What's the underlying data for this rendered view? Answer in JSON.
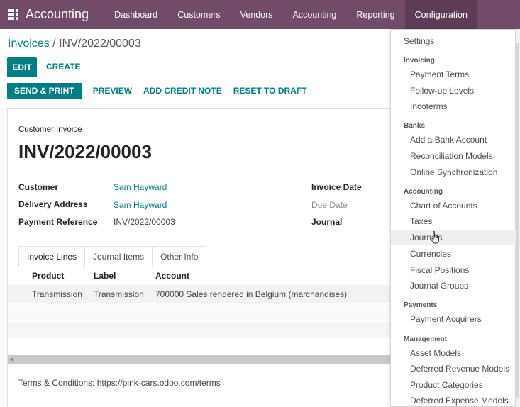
{
  "navbar": {
    "brand": "Accounting",
    "items": [
      "Dashboard",
      "Customers",
      "Vendors",
      "Accounting",
      "Reporting",
      "Configuration"
    ],
    "bg_color": "#714B67"
  },
  "breadcrumb": {
    "parent": "Invoices",
    "separator": "/",
    "current": "INV/2022/00003"
  },
  "actions": {
    "edit": "EDIT",
    "create": "CREATE",
    "send_print": "SEND & PRINT",
    "preview": "PREVIEW",
    "add_credit_note": "ADD CREDIT NOTE",
    "reset_to_draft": "RESET TO DRAFT"
  },
  "invoice": {
    "type": "Customer Invoice",
    "name": "INV/2022/00003",
    "customer_label": "Customer",
    "customer": "Sam Hayward",
    "delivery_label": "Delivery Address",
    "delivery": "Sam Hayward",
    "payment_ref_label": "Payment Reference",
    "payment_ref": "INV/2022/00003",
    "invoice_date_label": "Invoice Date",
    "due_date_label": "Due Date",
    "journal_label": "Journal"
  },
  "tabs": [
    "Invoice Lines",
    "Journal Items",
    "Other Info"
  ],
  "lines": {
    "headers": [
      "Product",
      "Label",
      "Account"
    ],
    "rows": [
      {
        "product": "Transmission",
        "label": "Transmission",
        "account": "700000 Sales rendered in Belgium (marchandises)"
      }
    ]
  },
  "terms": "Terms & Conditions: https://pink-cars.odoo.com/terms",
  "menu": {
    "settings": "Settings",
    "sections": [
      {
        "header": "Invoicing",
        "items": [
          "Payment Terms",
          "Follow-up Levels",
          "Incoterms"
        ]
      },
      {
        "header": "Banks",
        "items": [
          "Add a Bank Account",
          "Reconciliation Models",
          "Online Synchronization"
        ]
      },
      {
        "header": "Accounting",
        "items": [
          "Chart of Accounts",
          "Taxes",
          "Journals",
          "Currencies",
          "Fiscal Positions",
          "Journal Groups"
        ]
      },
      {
        "header": "Payments",
        "items": [
          "Payment Acquirers"
        ]
      },
      {
        "header": "Management",
        "items": [
          "Asset Models",
          "Deferred Revenue Models",
          "Product Categories",
          "Deferred Expense Models"
        ]
      }
    ]
  },
  "accent_color": "#017e84"
}
